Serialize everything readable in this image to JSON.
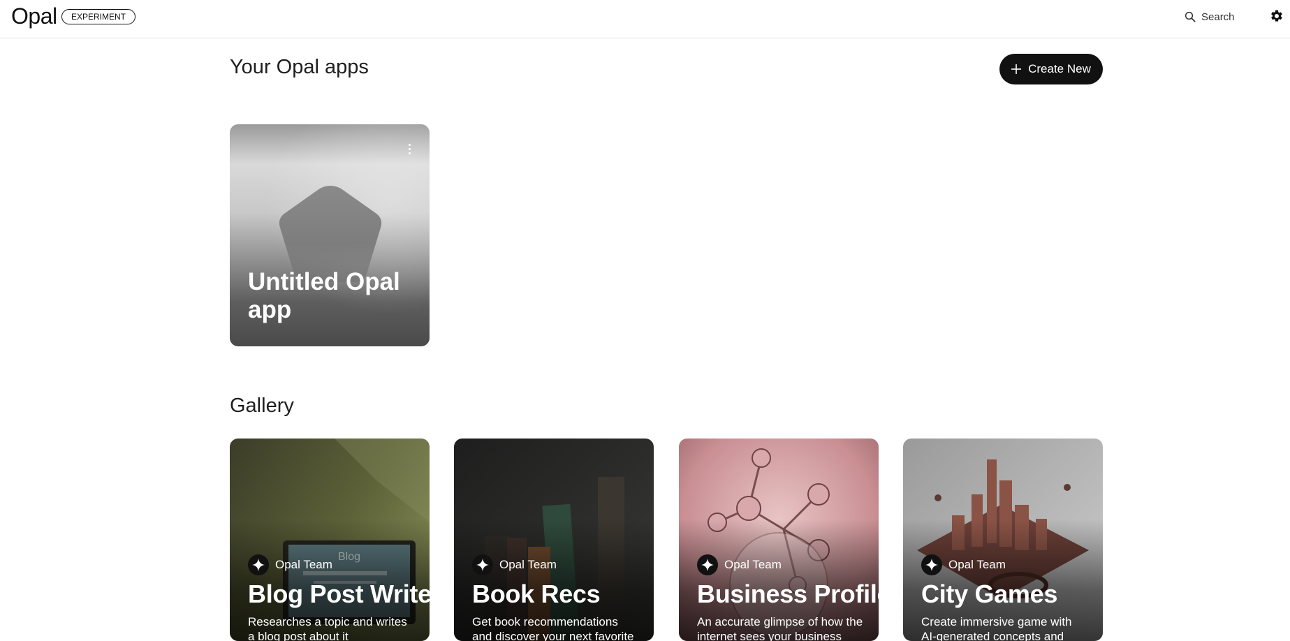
{
  "header": {
    "logo": "Opal",
    "badge": "EXPERIMENT",
    "search_label": "Search",
    "settings_icon": "gear-icon"
  },
  "apps_section": {
    "title": "Your Opal apps",
    "create_label": "Create New",
    "apps": [
      {
        "title": "Untitled Opal app"
      }
    ]
  },
  "gallery": {
    "title": "Gallery",
    "items": [
      {
        "author": "Opal Team",
        "title": "Blog Post Writer",
        "description": "Researches a topic and writes a blog post about it"
      },
      {
        "author": "Opal Team",
        "title": "Book Recs",
        "description": "Get book recommendations and discover your next favorite read"
      },
      {
        "author": "Opal Team",
        "title": "Business Profiler",
        "description": "An accurate glimpse of how the internet sees your business"
      },
      {
        "author": "Opal Team",
        "title": "City Games",
        "description": "Create immersive game with AI-generated concepts and visuals"
      }
    ]
  },
  "colors": {
    "button_bg": "#111111",
    "card_text": "#ffffff"
  }
}
